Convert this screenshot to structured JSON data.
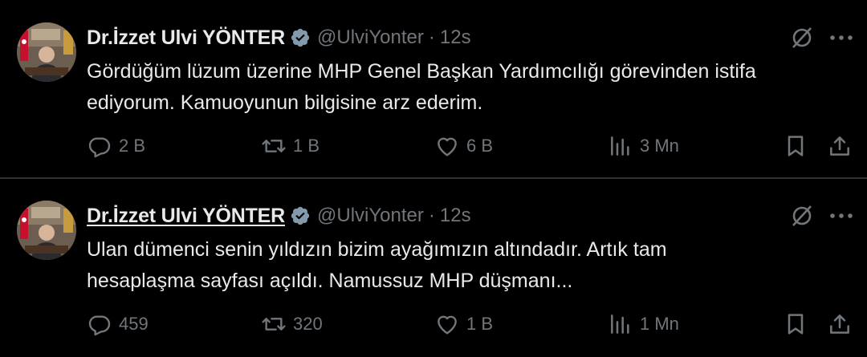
{
  "tweets": [
    {
      "author_name": "Dr.İzzet Ulvi YÖNTER",
      "handle": "@UlviYonter",
      "separator": "·",
      "time": "12s",
      "text_lines": [
        "Gördüğüm lüzum üzerine MHP Genel Başkan Yardımcılığı görevinden istifa",
        "ediyorum. Kamuoyunun bilgisine arz ederim."
      ],
      "replies": "2 B",
      "retweets": "1 B",
      "likes": "6 B",
      "views": "3 Mn"
    },
    {
      "author_name": "Dr.İzzet Ulvi YÖNTER",
      "handle": "@UlviYonter",
      "separator": "·",
      "time": "12s",
      "text_lines": [
        "Ulan dümenci senin yıldızın bizim ayağımızın altındadır. Artık tam",
        "hesaplaşma sayfası açıldı. Namussuz MHP düşmanı..."
      ],
      "replies": "459",
      "retweets": "320",
      "likes": "1 B",
      "views": "1 Mn"
    }
  ],
  "icons": {
    "verified": "verified-badge-icon",
    "grok": "grok-icon",
    "more": "more-icon",
    "reply": "reply-icon",
    "retweet": "retweet-icon",
    "like": "like-icon",
    "views": "views-icon",
    "bookmark": "bookmark-icon",
    "share": "share-icon"
  },
  "colors": {
    "background": "#000000",
    "text": "#e7e9ea",
    "muted": "#71767b",
    "divider": "#2f3336"
  }
}
